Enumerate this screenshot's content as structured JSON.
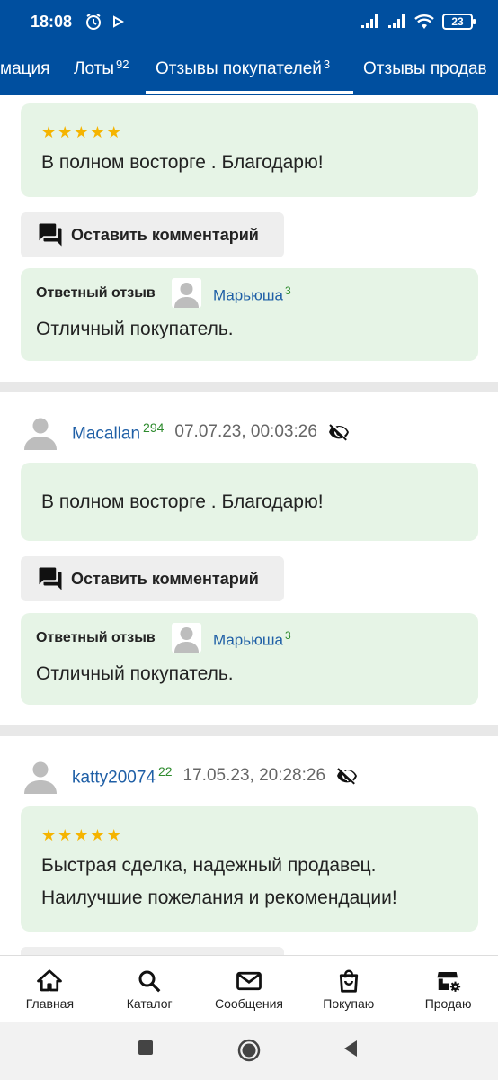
{
  "status_bar": {
    "time": "18:08",
    "battery": "23"
  },
  "tabs": [
    {
      "label": "мация",
      "count": ""
    },
    {
      "label": "Лоты",
      "count": "92"
    },
    {
      "label": "Отзывы покупателей",
      "count": "3"
    },
    {
      "label": "Отзывы продав",
      "count": ""
    }
  ],
  "reviews": [
    {
      "author": "",
      "rating": "",
      "date": "",
      "stars": 5,
      "text": "В полном восторге . Благодарю!",
      "comment_button": "Оставить комментарий",
      "reply": {
        "title": "Ответный отзыв",
        "user": "Марьюша",
        "user_rating": "3",
        "text": "Отличный покупатель."
      }
    },
    {
      "author": "Macallan",
      "rating": "294",
      "date": "07.07.23, 00:03:26",
      "stars": 0,
      "text": "В полном восторге . Благодарю!",
      "comment_button": "Оставить комментарий",
      "reply": {
        "title": "Ответный отзыв",
        "user": "Марьюша",
        "user_rating": "3",
        "text": "Отличный покупатель."
      }
    },
    {
      "author": "katty20074",
      "rating": "22",
      "date": "17.05.23, 20:28:26",
      "stars": 5,
      "text_line1": "Быстрая сделка, надежный продавец.",
      "text_line2": "Наилучшие пожелания и рекомендации!"
    }
  ],
  "bottom_nav": [
    {
      "label": "Главная",
      "icon": "home-icon"
    },
    {
      "label": "Каталог",
      "icon": "search-icon"
    },
    {
      "label": "Сообщения",
      "icon": "mail-icon"
    },
    {
      "label": "Покупаю",
      "icon": "shopping-bag-icon"
    },
    {
      "label": "Продаю",
      "icon": "store-settings-icon"
    }
  ],
  "colors": {
    "brand": "#004f9f",
    "card": "#e6f4e6",
    "link": "#1f5fa6",
    "rating": "#2e8b2e",
    "star": "#f5b400"
  }
}
